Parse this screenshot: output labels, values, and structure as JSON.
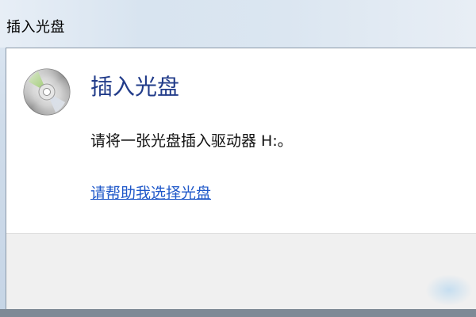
{
  "window": {
    "title": "插入光盘"
  },
  "dialog": {
    "icon": "cd-disc-icon",
    "heading": "插入光盘",
    "message": "请将一张光盘插入驱动器 H:。",
    "help_link": "请帮助我选择光盘"
  },
  "colors": {
    "heading": "#223c8a",
    "link": "#1f58c9",
    "footer": "#f0f0f0"
  }
}
